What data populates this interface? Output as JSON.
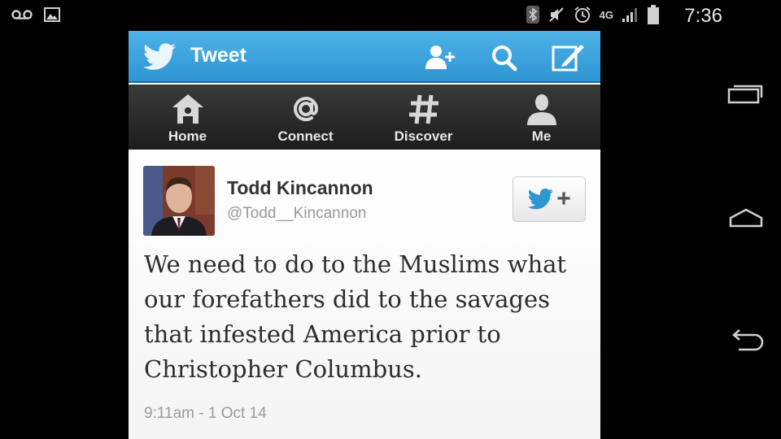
{
  "status_bar": {
    "time": "7:36",
    "network": "4G",
    "icons": [
      "voicemail-icon",
      "image-icon",
      "bluetooth-icon",
      "mute-icon",
      "alarm-icon",
      "signal-icon",
      "battery-icon"
    ]
  },
  "header": {
    "title": "Tweet",
    "icons": [
      "add-user-icon",
      "search-icon",
      "compose-icon"
    ],
    "accent_color": "#2e95d3"
  },
  "tabs": [
    {
      "label": "Home",
      "icon": "home-icon"
    },
    {
      "label": "Connect",
      "icon": "at-icon"
    },
    {
      "label": "Discover",
      "icon": "hash-icon"
    },
    {
      "label": "Me",
      "icon": "person-icon"
    }
  ],
  "tweet": {
    "name": "Todd Kincannon",
    "handle": "@Todd__Kincannon",
    "follow_symbol": "+",
    "text": "We need to do to the Muslims what our forefathers did to the savages that infested America prior to Christopher Columbus.",
    "timestamp": "9:11am - 1 Oct 14"
  },
  "android_nav": [
    "recent-apps-icon",
    "home-nav-icon",
    "back-icon"
  ]
}
